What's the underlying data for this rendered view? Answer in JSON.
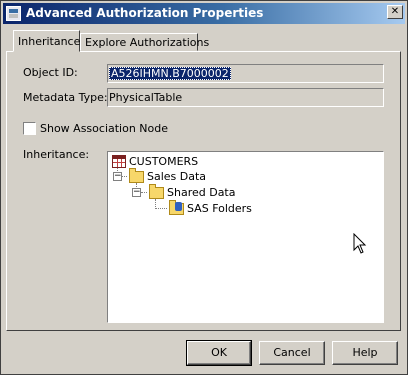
{
  "window": {
    "title": "Advanced Authorization Properties",
    "close_glyph": "✕"
  },
  "tabs": [
    {
      "label": "Inheritance",
      "active": true
    },
    {
      "label": "Explore Authorizations",
      "active": false
    }
  ],
  "form": {
    "object_id_label": "Object ID:",
    "object_id_value": "A526IHMN.B7000002",
    "metadata_type_label": "Metadata Type:",
    "metadata_type_value": "PhysicalTable",
    "show_association_label": "Show Association Node",
    "show_association_checked": false,
    "inheritance_label": "Inheritance:"
  },
  "tree": {
    "nodes": [
      {
        "label": "CUSTOMERS",
        "icon": "table-icon"
      },
      {
        "label": "Sales Data",
        "icon": "folder-icon",
        "expanded": true
      },
      {
        "label": "Shared Data",
        "icon": "folder-icon",
        "expanded": true
      },
      {
        "label": "SAS Folders",
        "icon": "repository-folder-icon"
      }
    ]
  },
  "buttons": {
    "ok": "OK",
    "cancel": "Cancel",
    "help": "Help"
  },
  "colors": {
    "title_start": "#0a246a",
    "title_end": "#a6caf0",
    "face": "#d4d0c8",
    "selection": "#0a246a"
  }
}
